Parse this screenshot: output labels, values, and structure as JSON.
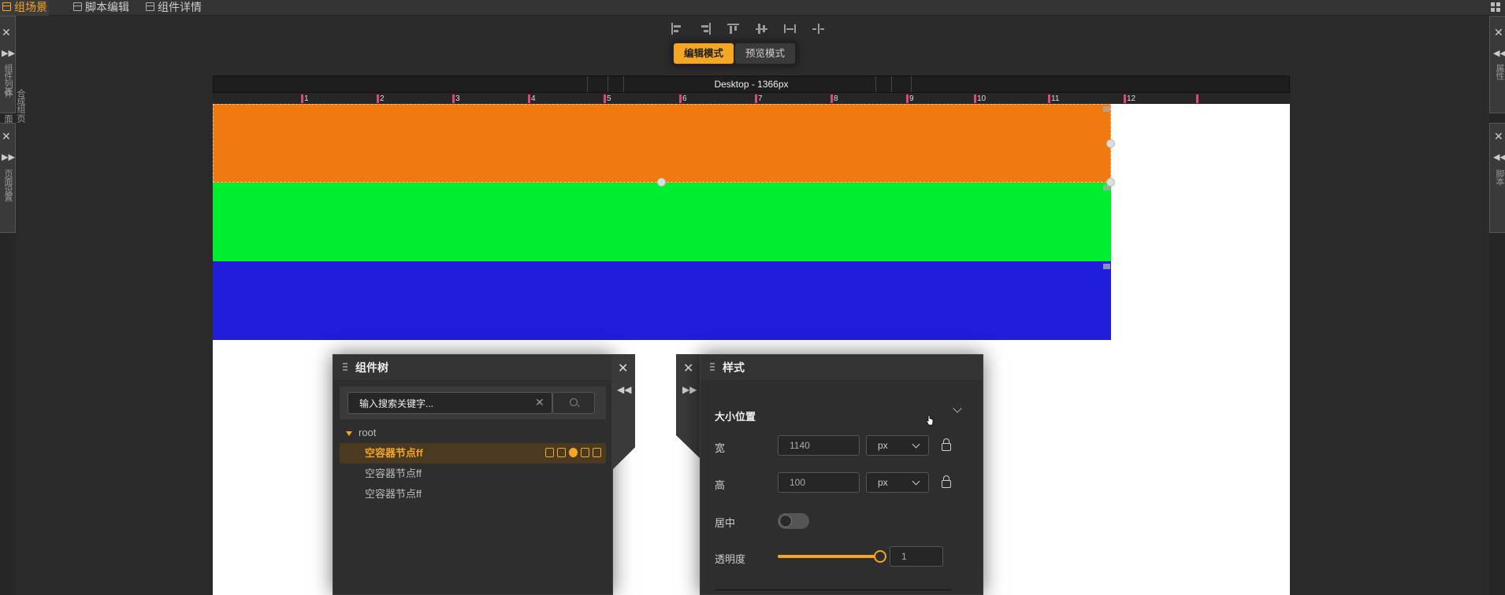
{
  "menubar": {
    "tabs": [
      {
        "label": "组场景",
        "active": true
      },
      {
        "label": "脚本编辑",
        "active": false
      },
      {
        "label": "组件详情",
        "active": false
      }
    ]
  },
  "toolbar": {
    "align_icons": [
      "align-left-icon",
      "align-right-icon",
      "align-top-icon",
      "align-vcenter-icon",
      "distribute-horizontal-icon",
      "distribute-spacing-icon"
    ],
    "modes": [
      {
        "label": "编辑模式",
        "active": true
      },
      {
        "label": "预览模式",
        "active": false
      }
    ]
  },
  "canvas": {
    "device_label": "Desktop - 1366px",
    "ruler_ticks": [
      "1",
      "2",
      "3",
      "4",
      "5",
      "6",
      "7",
      "8",
      "9",
      "10",
      "11",
      "12"
    ],
    "blocks": [
      {
        "color": "#ef7a10"
      },
      {
        "color": "#00ee30"
      },
      {
        "color": "#201ddb"
      }
    ]
  },
  "left_edge": {
    "tab1_label": "组件列表",
    "tab1_label_b": "合成组件",
    "tab1_label_c": "页面",
    "tab2_label": "页面设置"
  },
  "right_edge": {
    "tab1_label": "属性",
    "tab2_label": "脚本"
  },
  "tree_panel": {
    "title": "组件树",
    "search_placeholder": "输入搜索关键字...",
    "root_label": "root",
    "nodes": [
      {
        "label": "空容器节点ff",
        "selected": true
      },
      {
        "label": "空容器节点ff",
        "selected": false
      },
      {
        "label": "空容器节点ff",
        "selected": false
      }
    ]
  },
  "style_panel": {
    "title": "样式",
    "section_title": "大小位置",
    "width_label": "宽",
    "width_value": "1140",
    "width_unit": "px",
    "height_label": "高",
    "height_value": "100",
    "height_unit": "px",
    "center_label": "居中",
    "center_on": false,
    "opacity_label": "透明度",
    "opacity_value": "1",
    "opacity_level": 1
  },
  "colors": {
    "accent": "#f5a623",
    "ruler_mark": "#e0457b"
  }
}
